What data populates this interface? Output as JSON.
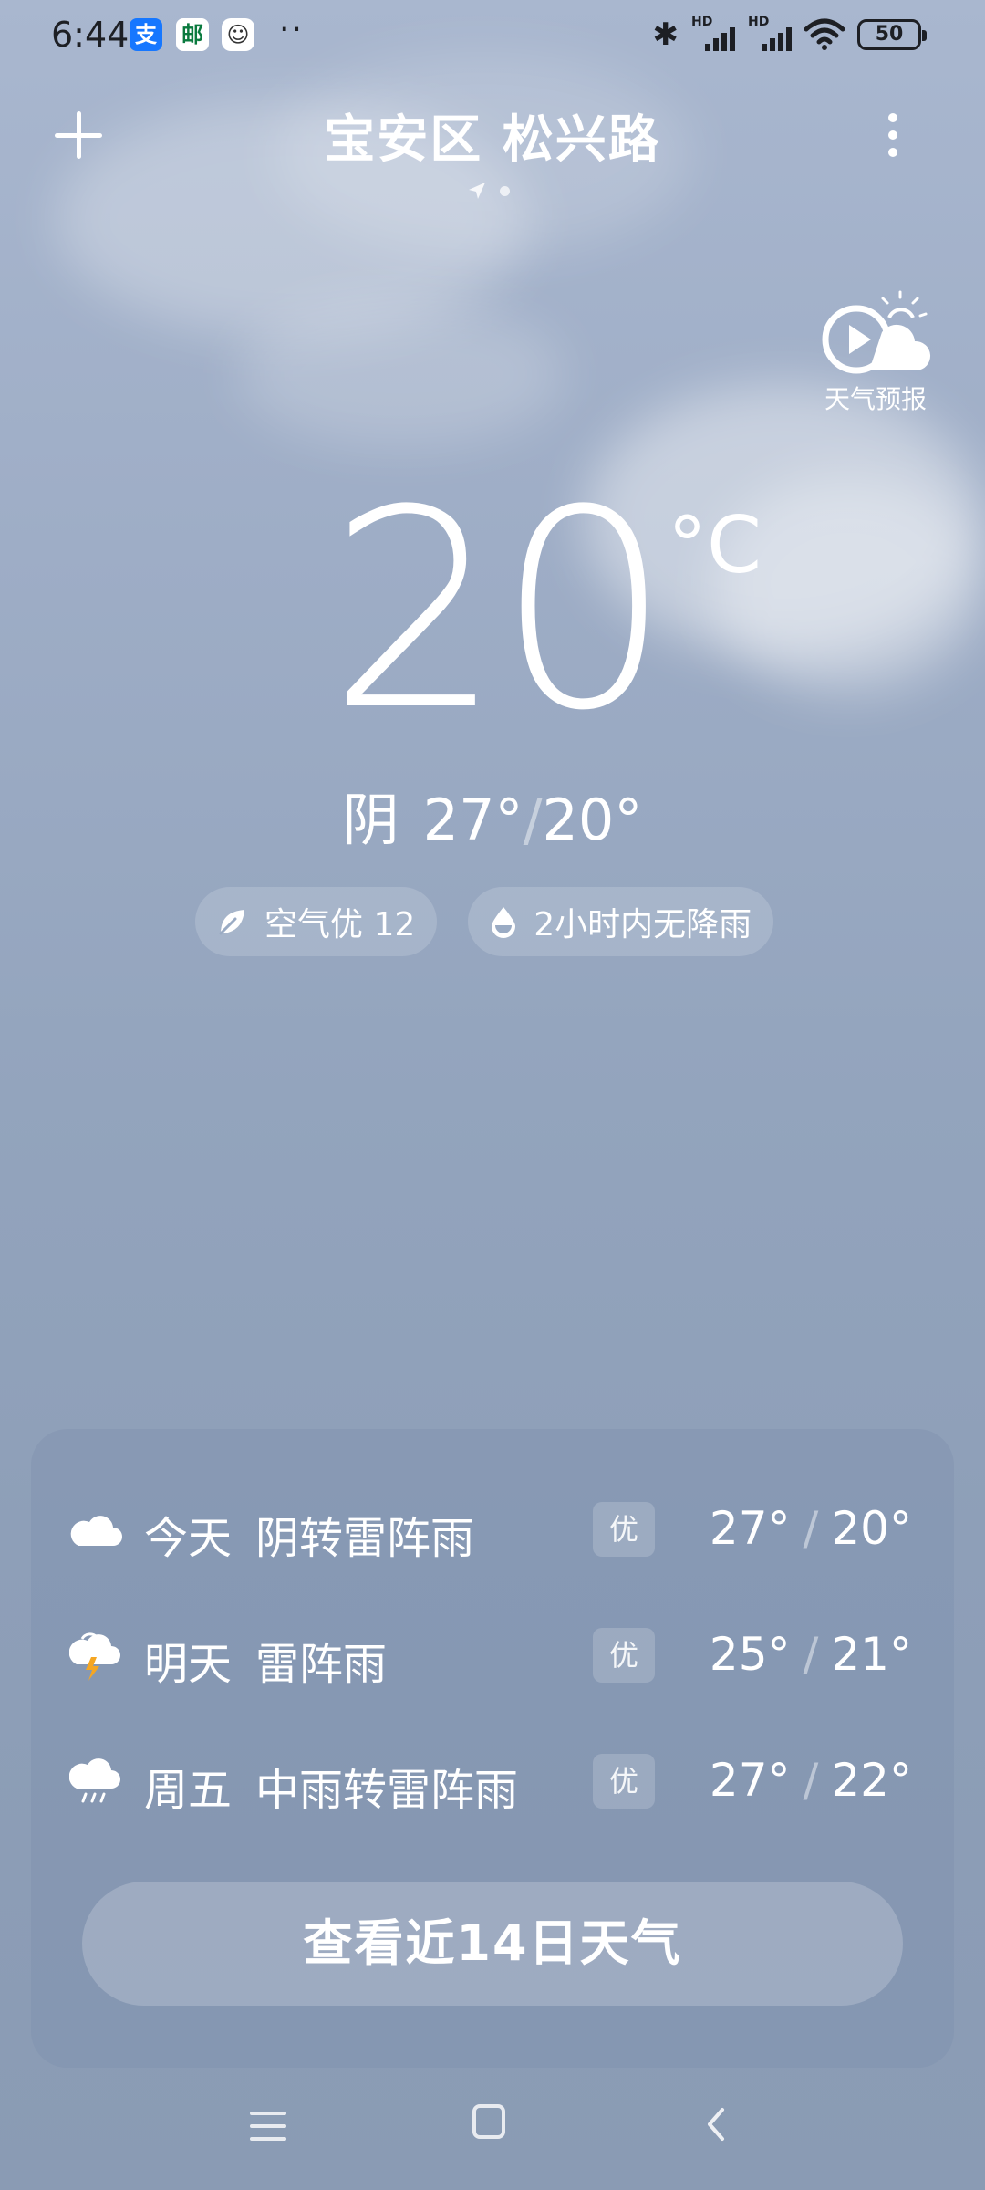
{
  "status_bar": {
    "time": "6:44",
    "alipay_glyph": "支",
    "post_glyph": "邮",
    "avatar_glyph": "☺",
    "more_dots": "··",
    "bluetooth_glyph": "✱",
    "hd": "HD",
    "battery": "50"
  },
  "header": {
    "location": "宝安区 松兴路"
  },
  "forecast_video": {
    "label": "天气预报"
  },
  "current": {
    "temp": "20",
    "unit": "°C",
    "condition": "阴",
    "high": "27°",
    "sep": "/",
    "low": "20°"
  },
  "chips": {
    "air": "空气优 12",
    "rain": "2小时内无降雨"
  },
  "forecast": [
    {
      "day": "今天",
      "condition": "阴转雷阵雨",
      "aqi": "优",
      "high": "27°",
      "low": "20°",
      "icon": "cloud-icon"
    },
    {
      "day": "明天",
      "condition": "雷阵雨",
      "aqi": "优",
      "high": "25°",
      "low": "21°",
      "icon": "thunderstorm-icon"
    },
    {
      "day": "周五",
      "condition": "中雨转雷阵雨",
      "aqi": "优",
      "high": "27°",
      "low": "22°",
      "icon": "rain-icon"
    }
  ],
  "button_14day": "查看近14日天气",
  "colors": {
    "background_top": "#a9b7cf",
    "background_bottom": "#8a9bb4",
    "text": "#ffffff",
    "lightning": "#f5a623"
  }
}
